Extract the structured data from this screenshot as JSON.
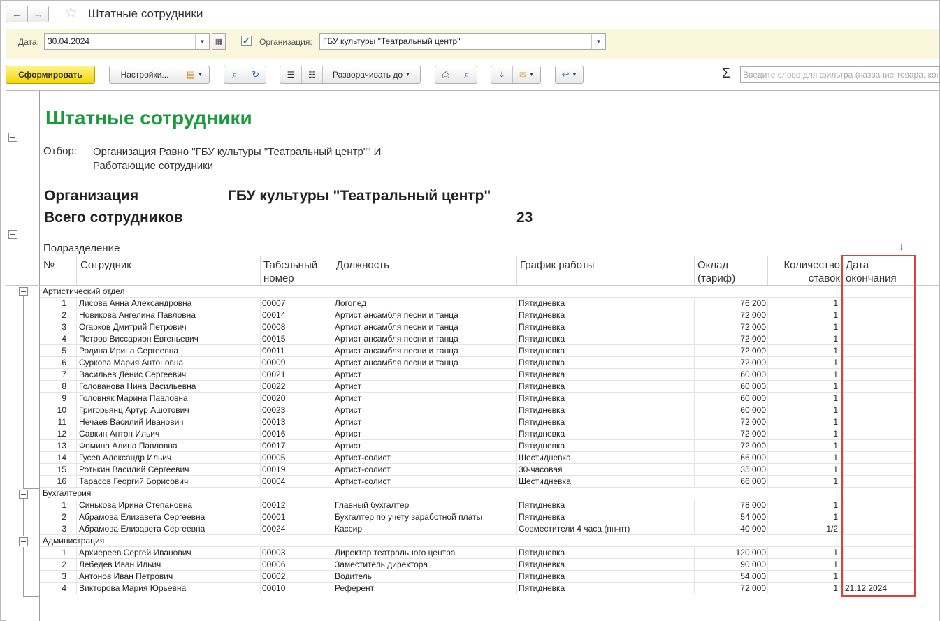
{
  "window": {
    "title": "Штатные сотрудники",
    "nav_back": "←",
    "nav_forward": "→",
    "favorite_icon": "star-icon"
  },
  "params": {
    "date_label": "Дата:",
    "date_value": "30.04.2024",
    "org_checked": true,
    "org_label": "Организация:",
    "org_value": "ГБУ культуры \"Театральный центр\""
  },
  "toolbar": {
    "generate": "Сформировать",
    "settings": "Настройки...",
    "expand_to": "Разворачивать до",
    "sigma": "Σ",
    "search_placeholder": "Введите слово для фильтра (название товара, контрагента и т.п.)"
  },
  "report": {
    "title": "Штатные сотрудники",
    "filter_label": "Отбор:",
    "filter_line1": "Организация Равно \"ГБУ культуры \"Театральный центр\"\" И",
    "filter_line2": "Работающие сотрудники",
    "org_caption": "Организация",
    "org_value": "ГБУ культуры \"Театральный центр\"",
    "total_caption": "Всего сотрудников",
    "total_value": "23",
    "columns": {
      "department": "Подразделение",
      "num": "№",
      "employee": "Сотрудник",
      "tab_num_1": "Табельный",
      "tab_num_2": "номер",
      "position": "Должность",
      "schedule": "График работы",
      "salary_1": "Оклад",
      "salary_2": "(тариф)",
      "rate_1": "Количество",
      "rate_2": "ставок",
      "end_1": "Дата",
      "end_2": "окончания"
    },
    "groups": [
      {
        "name": "Артистический отдел",
        "rows": [
          {
            "n": "1",
            "name": "Лисова Анна Александровна",
            "tab": "00007",
            "pos": "Логопед",
            "sch": "Пятидневка",
            "sal": "76 200",
            "rate": "1",
            "end": ""
          },
          {
            "n": "2",
            "name": "Новикова Ангелина Павловна",
            "tab": "00014",
            "pos": "Артист ансамбля песни и танца",
            "sch": "Пятидневка",
            "sal": "72 000",
            "rate": "1",
            "end": ""
          },
          {
            "n": "3",
            "name": "Огарков Дмитрий Петрович",
            "tab": "00008",
            "pos": "Артист ансамбля песни и танца",
            "sch": "Пятидневка",
            "sal": "72 000",
            "rate": "1",
            "end": ""
          },
          {
            "n": "4",
            "name": "Петров Виссарион Евгеньевич",
            "tab": "00015",
            "pos": "Артист ансамбля песни и танца",
            "sch": "Пятидневка",
            "sal": "72 000",
            "rate": "1",
            "end": ""
          },
          {
            "n": "5",
            "name": "Родина Ирина Сергеевна",
            "tab": "00011",
            "pos": "Артист ансамбля песни и танца",
            "sch": "Пятидневка",
            "sal": "72 000",
            "rate": "1",
            "end": ""
          },
          {
            "n": "6",
            "name": "Суркова Мария Антоновна",
            "tab": "00009",
            "pos": "Артист ансамбля песни и танца",
            "sch": "Пятидневка",
            "sal": "72 000",
            "rate": "1",
            "end": ""
          },
          {
            "n": "7",
            "name": "Васильев Денис Сергеевич",
            "tab": "00021",
            "pos": "Артист",
            "sch": "Пятидневка",
            "sal": "60 000",
            "rate": "1",
            "end": ""
          },
          {
            "n": "8",
            "name": "Голованова Нина Васильевна",
            "tab": "00022",
            "pos": "Артист",
            "sch": "Пятидневка",
            "sal": "60 000",
            "rate": "1",
            "end": ""
          },
          {
            "n": "9",
            "name": "Головняк Марина Павловна",
            "tab": "00020",
            "pos": "Артист",
            "sch": "Пятидневка",
            "sal": "60 000",
            "rate": "1",
            "end": ""
          },
          {
            "n": "10",
            "name": "Григорьянц Артур Ашотович",
            "tab": "00023",
            "pos": "Артист",
            "sch": "Пятидневка",
            "sal": "60 000",
            "rate": "1",
            "end": ""
          },
          {
            "n": "11",
            "name": "Нечаев Василий Иванович",
            "tab": "00013",
            "pos": "Артист",
            "sch": "Пятидневка",
            "sal": "72 000",
            "rate": "1",
            "end": ""
          },
          {
            "n": "12",
            "name": "Савкин Антон Ильич",
            "tab": "00016",
            "pos": "Артист",
            "sch": "Пятидневка",
            "sal": "72 000",
            "rate": "1",
            "end": ""
          },
          {
            "n": "13",
            "name": "Фомина Алина Павловна",
            "tab": "00017",
            "pos": "Артист",
            "sch": "Пятидневка",
            "sal": "72 000",
            "rate": "1",
            "end": ""
          },
          {
            "n": "14",
            "name": "Гусев Александр Ильич",
            "tab": "00005",
            "pos": "Артист-солист",
            "sch": "Шестидневка",
            "sal": "66 000",
            "rate": "1",
            "end": ""
          },
          {
            "n": "15",
            "name": "Ротькин Василий Сергеевич",
            "tab": "00019",
            "pos": "Артист-солист",
            "sch": "30-часовая",
            "sal": "35 000",
            "rate": "1",
            "end": ""
          },
          {
            "n": "16",
            "name": "Тарасов Георгий Борисович",
            "tab": "00004",
            "pos": "Артист-солист",
            "sch": "Шестидневка",
            "sal": "66 000",
            "rate": "1",
            "end": ""
          }
        ]
      },
      {
        "name": "Бухгалтерия",
        "rows": [
          {
            "n": "1",
            "name": "Синькова Ирина Степановна",
            "tab": "00012",
            "pos": "Главный бухгалтер",
            "sch": "Пятидневка",
            "sal": "78 000",
            "rate": "1",
            "end": ""
          },
          {
            "n": "2",
            "name": "Абрамова Елизавета Сергеевна",
            "tab": "00001",
            "pos": "Бухгалтер по учету заработной платы",
            "sch": "Пятидневка",
            "sal": "54 000",
            "rate": "1",
            "end": ""
          },
          {
            "n": "3",
            "name": "Абрамова Елизавета Сергеевна",
            "tab": "00024",
            "pos": "Кассир",
            "sch": "Совместители 4 часа (пн-пт)",
            "sal": "40 000",
            "rate": "1/2",
            "end": ""
          }
        ]
      },
      {
        "name": "Администрация",
        "rows": [
          {
            "n": "1",
            "name": "Архиереев Сергей Иванович",
            "tab": "00003",
            "pos": "Директор театрального центра",
            "sch": "Пятидневка",
            "sal": "120 000",
            "rate": "1",
            "end": ""
          },
          {
            "n": "2",
            "name": "Лебедев Иван Ильич",
            "tab": "00006",
            "pos": "Заместитель директора",
            "sch": "Пятидневка",
            "sal": "90 000",
            "rate": "1",
            "end": ""
          },
          {
            "n": "3",
            "name": "Антонов Иван Петрович",
            "tab": "00002",
            "pos": "Водитель",
            "sch": "Пятидневка",
            "sal": "54 000",
            "rate": "1",
            "end": ""
          },
          {
            "n": "4",
            "name": "Викторова Мария Юрьевна",
            "tab": "00010",
            "pos": "Референт",
            "sch": "Пятидневка",
            "sal": "72 000",
            "rate": "1",
            "end": "21.12.2024"
          }
        ]
      }
    ]
  },
  "colors": {
    "accent_title": "#1a9a3c",
    "primary_button": "#f3d600",
    "params_bg": "#fbf7dc",
    "highlight_box": "#e0403a"
  }
}
